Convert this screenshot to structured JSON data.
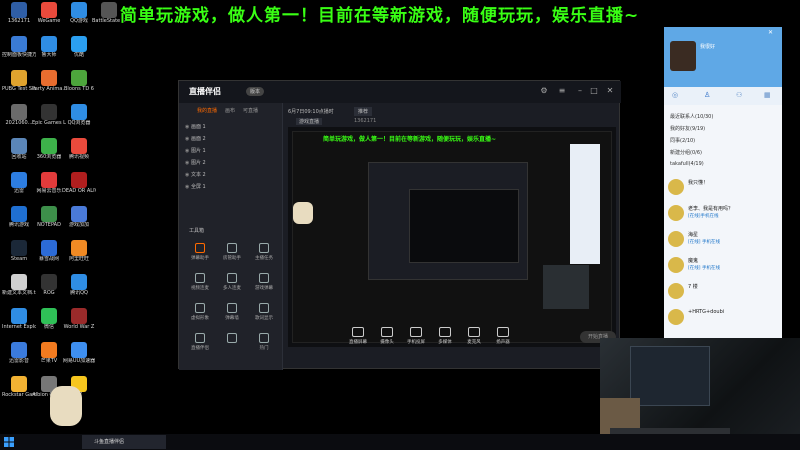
{
  "headline": "简单玩游戏，做人第一！目前在等新游戏，随便玩玩，娱乐直播~",
  "desktop_icons": [
    {
      "label": "1362171",
      "color": "#2f5ea6"
    },
    {
      "label": "控制面板快捷方式",
      "color": "#3a7bd5"
    },
    {
      "label": "PUBG Test Server",
      "color": "#e0a32e"
    },
    {
      "label": "2021060...",
      "color": "#6b6b6b"
    },
    {
      "label": "回收站",
      "color": "#5b86b8"
    },
    {
      "label": "迅雷",
      "color": "#2d7de0"
    },
    {
      "label": "腾讯游戏",
      "color": "#1f6fd1"
    },
    {
      "label": "Steam",
      "color": "#1b2838"
    },
    {
      "label": "新建文本文档.txt",
      "color": "#d0d0d0"
    },
    {
      "label": "Internet Explorer",
      "color": "#2f8de4"
    },
    {
      "label": "迅雷影音",
      "color": "#3b7bdc"
    },
    {
      "label": "Rockstar Games...",
      "color": "#f2b233"
    },
    {
      "label": "WeGame",
      "color": "#e94a3c"
    },
    {
      "label": "鲁大师",
      "color": "#2f8de4"
    },
    {
      "label": "Party Anima...",
      "color": "#e86d2f"
    },
    {
      "label": "Epic Games Launcher",
      "color": "#333333"
    },
    {
      "label": "360浏览器",
      "color": "#3db14a"
    },
    {
      "label": "网易云音乐",
      "color": "#e23b3b"
    },
    {
      "label": "NOTEPAD",
      "color": "#3d8f4a"
    },
    {
      "label": "暴雪战网",
      "color": "#2c6bd6"
    },
    {
      "label": "ROG",
      "color": "#333333"
    },
    {
      "label": "微信",
      "color": "#2fc057"
    },
    {
      "label": "芒果TV",
      "color": "#f27b20"
    },
    {
      "label": "Albion Online",
      "color": "#777777"
    },
    {
      "label": "QQ游戏",
      "color": "#2f8de4"
    },
    {
      "label": "优酷",
      "color": "#2b9ff0"
    },
    {
      "label": "Bloons TD 6",
      "color": "#4da53c"
    },
    {
      "label": "QQ浏览器",
      "color": "#2f8de4"
    },
    {
      "label": "腾讯视频",
      "color": "#e94a3c"
    },
    {
      "label": "DEAD OR ALIVE X...",
      "color": "#b01e1e"
    },
    {
      "label": "游戏加加",
      "color": "#4a7ad8"
    },
    {
      "label": "阿里旺旺",
      "color": "#f08a24"
    },
    {
      "label": "腾讯QQ",
      "color": "#2f8de4"
    },
    {
      "label": "World War Z",
      "color": "#9a2a2a"
    },
    {
      "label": "网易UU加速器",
      "color": "#3e8ff0"
    },
    {
      "label": "YY",
      "color": "#f6c61e"
    },
    {
      "label": "BattleState Games L...",
      "color": "#555555"
    }
  ],
  "app": {
    "logo": "直播伴侣",
    "version": "版本",
    "tabs": [
      "我的直播",
      "画布",
      "可直播"
    ],
    "scenes": [
      "画面 1",
      "画面 2",
      "图片 1",
      "图片 2",
      "文本 2",
      "全屏 1"
    ],
    "tools_title": "工具箱",
    "tools": [
      "弹幕助手",
      "房管助手",
      "主播任务",
      "视频连麦",
      "多人连麦",
      "游戏弹幕",
      "虚拟形象",
      "弹幕墙",
      "歌词显示",
      "直播伴侣",
      "",
      "热门"
    ],
    "preview_time": "6月7日09:10点播时",
    "preview_tag": "推荐",
    "room_label": "游戏直播",
    "room_id": "1362171",
    "bottom_buttons": [
      "直播屏幕",
      "摄像头",
      "手机投屏",
      "多媒体",
      "麦克风",
      "扬声器"
    ],
    "live_button": "开始直播"
  },
  "qq": {
    "username": "我很好",
    "groups": [
      "最近联系人(10/30)",
      "我的好友(9/19)",
      "同事(2/10)",
      "新建分组(0/6)",
      "takafull(4/19)"
    ],
    "contacts": [
      {
        "name": "我只懂！",
        "msg": ""
      },
      {
        "name": "老李、我是有用吗？",
        "msg": "[在线]手机在线"
      },
      {
        "name": "海星",
        "msg": "[在线] 手机在线"
      },
      {
        "name": "魔鬼",
        "msg": "[在线] 手机在线"
      },
      {
        "name": "7 楼",
        "msg": ""
      },
      {
        "name": "+HRTG+doubi",
        "msg": ""
      }
    ]
  },
  "taskbar": {
    "item": "斗鱼直播伴侣"
  },
  "colors": {
    "accent": "#ff6a00",
    "headline": "#39ff14",
    "qq_blue": "#5fa8e6"
  }
}
